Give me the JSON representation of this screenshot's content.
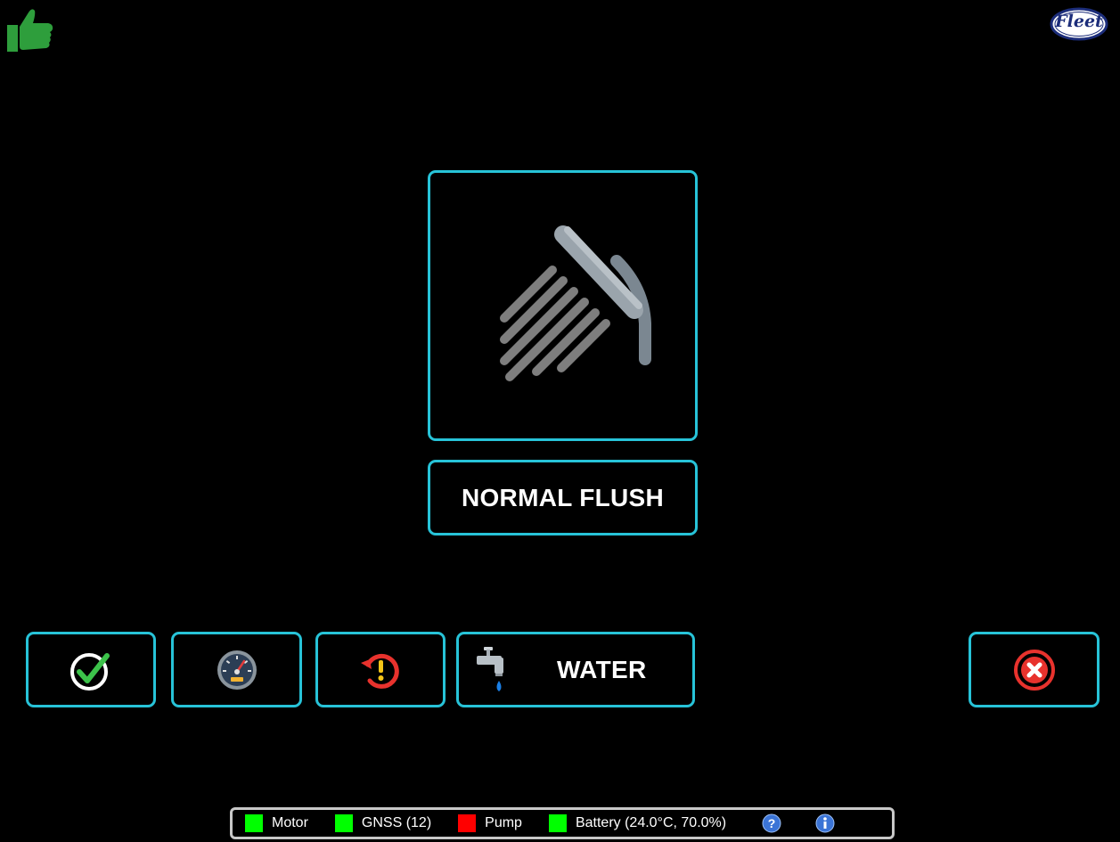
{
  "mode": {
    "label": "NORMAL FLUSH"
  },
  "toolbar": {
    "water_label": "WATER"
  },
  "icons": {
    "thumbs_up": "thumbs-up-icon",
    "logo": "fleet-logo",
    "flush": "shower-head-icon",
    "confirm": "check-circle-icon",
    "gauge": "speedometer-icon",
    "reset": "history-alert-icon",
    "water": "faucet-icon",
    "cancel": "close-circle-icon",
    "help": "help-icon",
    "info": "info-icon"
  },
  "logo_text": "Fleet",
  "status": [
    {
      "label": "Motor",
      "color": "#00ff00"
    },
    {
      "label": "GNSS (12)",
      "color": "#00ff00"
    },
    {
      "label": "Pump",
      "color": "#ff0000"
    },
    {
      "label": "Battery (24.0°C, 70.0%)",
      "color": "#00ff00"
    }
  ],
  "colors": {
    "accent": "#27c3d8",
    "ok": "#00ff00",
    "error": "#ff0000",
    "thumbs": "#2e9e3c"
  }
}
